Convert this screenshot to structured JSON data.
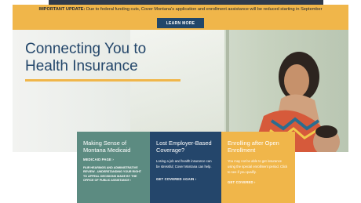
{
  "alert": {
    "label": "IMPORTANT UPDATE:",
    "message": "Due to federal funding cuts, Cover Montana's application and enrollment assistance will be reduced starting in September",
    "button": "LEARN MORE"
  },
  "hero": {
    "title": "Connecting You to Health Insurance"
  },
  "cards": [
    {
      "title": "Making Sense of Montana Medicaid",
      "links": [
        "MEDICAID PAGE ›",
        "FAIR HEARINGS AND ADMINISTRATIVE REVIEW - UNDERSTANDING YOUR RIGHT TO APPEAL DECISIONS MADE BY THE OFFICE OF PUBLIC ASSISTANCE ›"
      ]
    },
    {
      "title": "Lost Employer-Based Coverage?",
      "body": "Losing a job and health insurance can be stressful; Cover Montana can help.",
      "link": "GET COVERED AGAIN ›"
    },
    {
      "title": "Enrolling after Open Enrollment",
      "body": "You may not be able to get insurance using the special enrollment period. Click to see if you qualify.",
      "link": "GET COVERED ›"
    }
  ],
  "colors": {
    "alert_bg": "#f0b64a",
    "navy": "#24466b",
    "teal": "#5c8b81",
    "gold": "#f0b64a"
  }
}
